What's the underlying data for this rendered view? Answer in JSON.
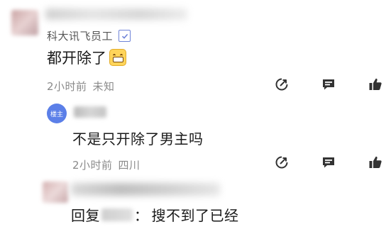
{
  "comment": {
    "username": "科大讯飞员工",
    "content": "都开除了",
    "time": "2小时前",
    "location": "未知"
  },
  "reply": {
    "badge": "楼主",
    "content": "不是只开除了男主吗",
    "time": "2小时前",
    "location": "四川"
  },
  "reply2": {
    "prefix": "回复",
    "separator": "：",
    "content": "搜不到了已经"
  },
  "colors": {
    "accent": "#5b7fe8",
    "meta": "#8a8a8a",
    "icon": "#333333"
  }
}
